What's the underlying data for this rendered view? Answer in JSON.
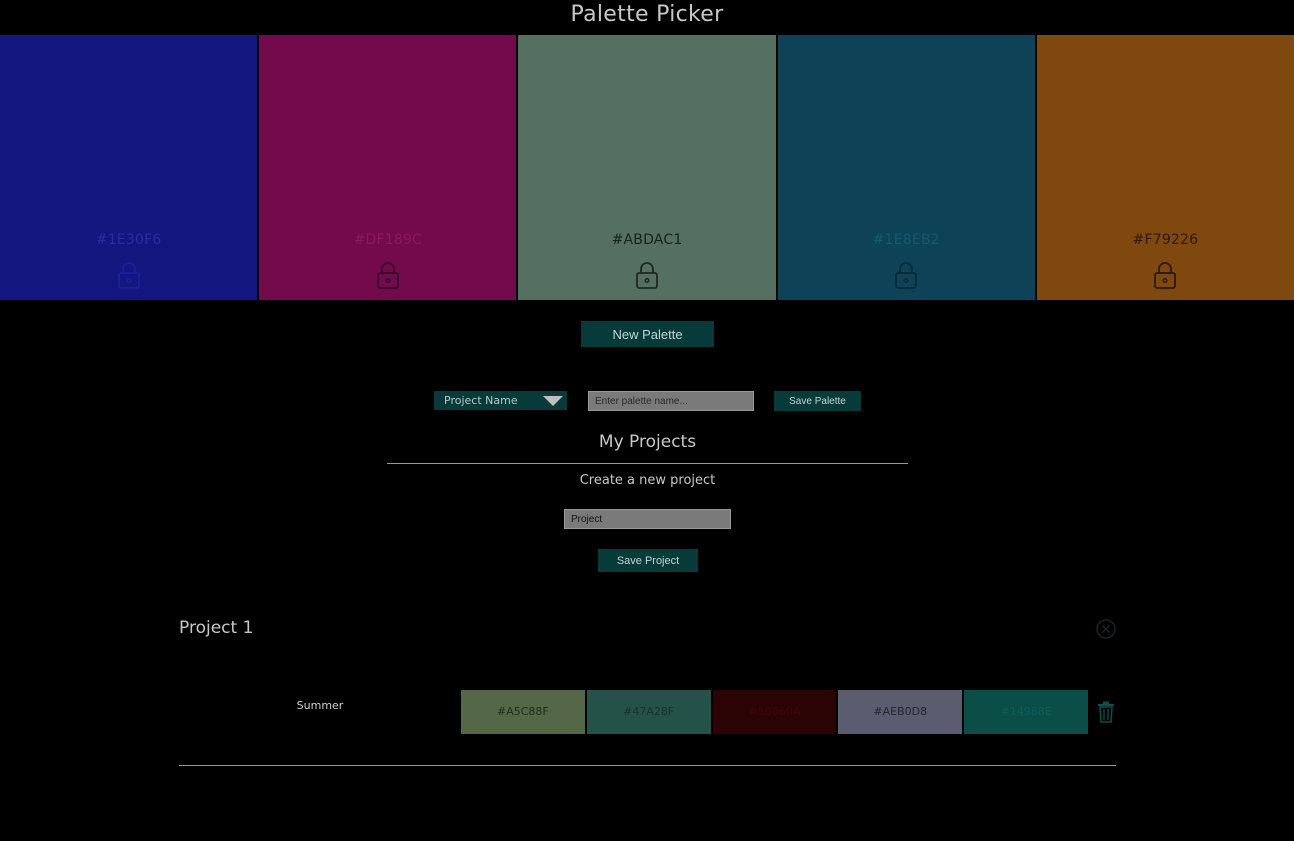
{
  "header": {
    "title": "Palette Picker"
  },
  "swatches": [
    {
      "hex": "#1E30F6",
      "bg": "#12167e",
      "text_color": "#2a2ca0",
      "icon_color": "#1a1fa0"
    },
    {
      "hex": "#DF189C",
      "bg": "#720a4b",
      "text_color": "#8a1a5e",
      "icon_color": "#3a0a2a"
    },
    {
      "hex": "#ABDAC1",
      "bg": "#557060",
      "text_color": "#16221c",
      "icon_color": "#1c2a22"
    },
    {
      "hex": "#1E8EB2",
      "bg": "#0e4357",
      "text_color": "#135a70",
      "icon_color": "#0a2a36"
    },
    {
      "hex": "#F79226",
      "bg": "#7f480e",
      "text_color": "#2a1904",
      "icon_color": "#2a1904"
    }
  ],
  "controls": {
    "new_palette_label": "New Palette",
    "project_select_value": "Project Name",
    "palette_name_placeholder": "Enter palette name...",
    "save_palette_label": "Save Palette"
  },
  "projects_section": {
    "title": "My Projects",
    "create_label": "Create a new project",
    "project_input_value": "Project",
    "save_project_label": "Save Project"
  },
  "project": {
    "name": "Project 1",
    "palettes": [
      {
        "name": "Summer",
        "colors": [
          {
            "hex": "#A5C88F",
            "bg": "#546848",
            "text_color": "#222e1d"
          },
          {
            "hex": "#47A28F",
            "bg": "#245248",
            "text_color": "#16342e"
          },
          {
            "hex": "#50060A",
            "bg": "#2b0305",
            "text_color": "#3e0608"
          },
          {
            "hex": "#AEB0D8",
            "bg": "#5b5c70",
            "text_color": "#25252e"
          },
          {
            "hex": "#14988E",
            "bg": "#0b4e48",
            "text_color": "#0c5e57"
          }
        ]
      }
    ]
  },
  "theme": {
    "background": "#000000",
    "button_bg": "#073b3a",
    "icon_dark": "#0a2a28",
    "trash_color": "#0d4f4c"
  }
}
